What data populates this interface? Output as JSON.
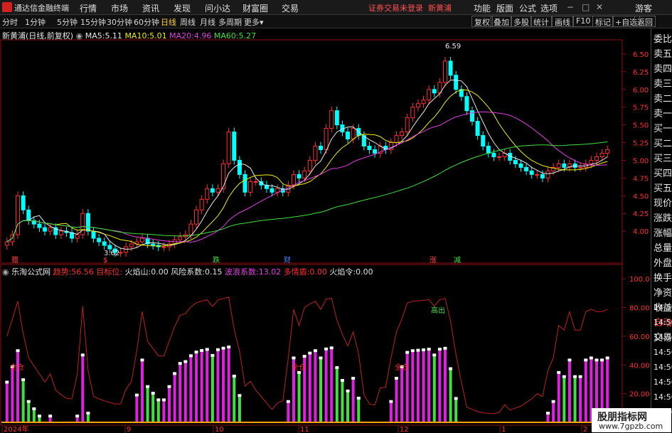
{
  "menubar": {
    "app_name": "通达信金融终端",
    "menus": [
      "行情",
      "市场",
      "资讯",
      "发现",
      "问小达",
      "财富圈",
      "交易"
    ],
    "warning": "证券交易未登录",
    "stock_name": "新黄浦",
    "right_menus": [
      "功能",
      "版面",
      "公式",
      "选项"
    ],
    "guest": "游客"
  },
  "toolbar": {
    "periods": [
      "分时",
      "1分钟",
      "5分钟",
      "15分钟",
      "30分钟",
      "60分钟",
      "日线",
      "周线",
      "月线",
      "多周期",
      "更多"
    ],
    "active_period": "日线",
    "right_buttons": [
      "复权",
      "叠加",
      "多股",
      "统计",
      "画线",
      "F10",
      "标记",
      "+自选",
      "返回"
    ]
  },
  "main_chart": {
    "title": "新黄浦(日线,前复权)",
    "ma": [
      {
        "label": "MA5:",
        "value": "5.11",
        "color": "#e8e8e8"
      },
      {
        "label": "MA10:",
        "value": "5.01",
        "color": "#f0f000"
      },
      {
        "label": "MA20:",
        "value": "4.96",
        "color": "#e040e0"
      },
      {
        "label": "MA60:",
        "value": "5.27",
        "color": "#40e040"
      }
    ],
    "price_axis": [
      "6.50",
      "6.25",
      "6.00",
      "5.75",
      "5.50",
      "5.25",
      "5.00",
      "4.75",
      "4.50",
      "4.25",
      "4.00"
    ],
    "high_label": "6.59",
    "low_label": "3.62",
    "markers": [
      {
        "text": "赠",
        "color": "#ff4040"
      },
      {
        "text": "$",
        "color": "#ff4040"
      },
      {
        "text": "跌",
        "color": "#40e040"
      },
      {
        "text": "财",
        "color": "#4080ff"
      },
      {
        "text": "涨",
        "color": "#ff4040"
      },
      {
        "text": "减",
        "color": "#40e040"
      }
    ]
  },
  "indicator": {
    "name": "乐淘公式网",
    "fields": [
      {
        "label": "趋势:",
        "value": "56.56",
        "color": "#ff3030"
      },
      {
        "label": "目标位:",
        "value": "",
        "color": "#ff3030"
      },
      {
        "label": "火焰山:",
        "value": "0.00",
        "color": "#e0e0e0"
      },
      {
        "label": "风险系数:",
        "value": "0.15",
        "color": "#e0e0e0"
      },
      {
        "label": "波浪系数:",
        "value": "13.02",
        "color": "#e040e0"
      },
      {
        "label": "多情盾:",
        "value": "0.00",
        "color": "#ff3030"
      },
      {
        "label": "火焰令:",
        "value": "0.00",
        "color": "#e0e0e0"
      }
    ],
    "axis": [
      "100.0",
      "80.00",
      "60.00",
      "40.00",
      "20.00"
    ],
    "labels": {
      "full": "全仓",
      "high_out": "高出"
    }
  },
  "date_axis": [
    "2024年",
    "9",
    "10",
    "11",
    "12",
    "1",
    "2"
  ],
  "right_panel": [
    "委比",
    "卖五",
    "卖四",
    "卖三",
    "卖二",
    "卖一",
    "买一",
    "买二",
    "买三",
    "买四",
    "买五",
    "现价",
    "涨跌",
    "涨幅",
    "总量",
    "外盘",
    "换手",
    "净资",
    "收益",
    "自动",
    "交易",
    "14:56",
    "14:56",
    "14:56",
    "14:56",
    "14:56",
    "14:56",
    "14:56",
    "14:56"
  ],
  "watermark": {
    "line1": "股朋指标网",
    "line2": "www.7gpzb.com"
  },
  "chart_data": {
    "type": "candlestick",
    "title": "新黄浦(日线,前复权)",
    "ylim": [
      3.55,
      6.7
    ],
    "high": 6.59,
    "low": 3.62,
    "closes": [
      3.85,
      3.95,
      4.5,
      4.3,
      4.15,
      4.1,
      4.05,
      4.0,
      4.05,
      3.95,
      4.0,
      3.98,
      3.9,
      3.95,
      4.25,
      4.0,
      3.9,
      3.85,
      3.8,
      3.75,
      3.7,
      3.7,
      3.78,
      3.82,
      3.85,
      3.9,
      3.82,
      3.8,
      3.78,
      3.78,
      3.82,
      3.88,
      3.92,
      3.95,
      4.1,
      4.3,
      4.45,
      4.6,
      4.55,
      4.6,
      4.95,
      5.4,
      5.0,
      4.8,
      4.55,
      4.7,
      4.7,
      4.65,
      4.6,
      4.55,
      4.6,
      4.55,
      4.65,
      4.8,
      4.75,
      4.85,
      5.0,
      5.2,
      5.15,
      5.45,
      5.7,
      5.5,
      5.4,
      5.3,
      5.45,
      5.35,
      5.2,
      5.15,
      5.1,
      5.2,
      5.15,
      5.25,
      5.35,
      5.4,
      5.6,
      5.75,
      5.8,
      5.85,
      6.0,
      5.95,
      6.1,
      6.4,
      6.2,
      6.0,
      5.9,
      5.7,
      5.55,
      5.35,
      5.2,
      5.1,
      5.05,
      5.05,
      5.1,
      5.0,
      4.95,
      4.9,
      4.85,
      4.8,
      4.8,
      4.75,
      4.85,
      4.9,
      4.95,
      4.9,
      4.95,
      4.9,
      4.9,
      4.95,
      5.0,
      5.05,
      5.1,
      5.15
    ],
    "ma_last": {
      "MA5": 5.11,
      "MA10": 5.01,
      "MA20": 4.96,
      "MA60": 5.27
    },
    "indicator_ylim": [
      0,
      110
    ],
    "trend_last": 56.56
  }
}
